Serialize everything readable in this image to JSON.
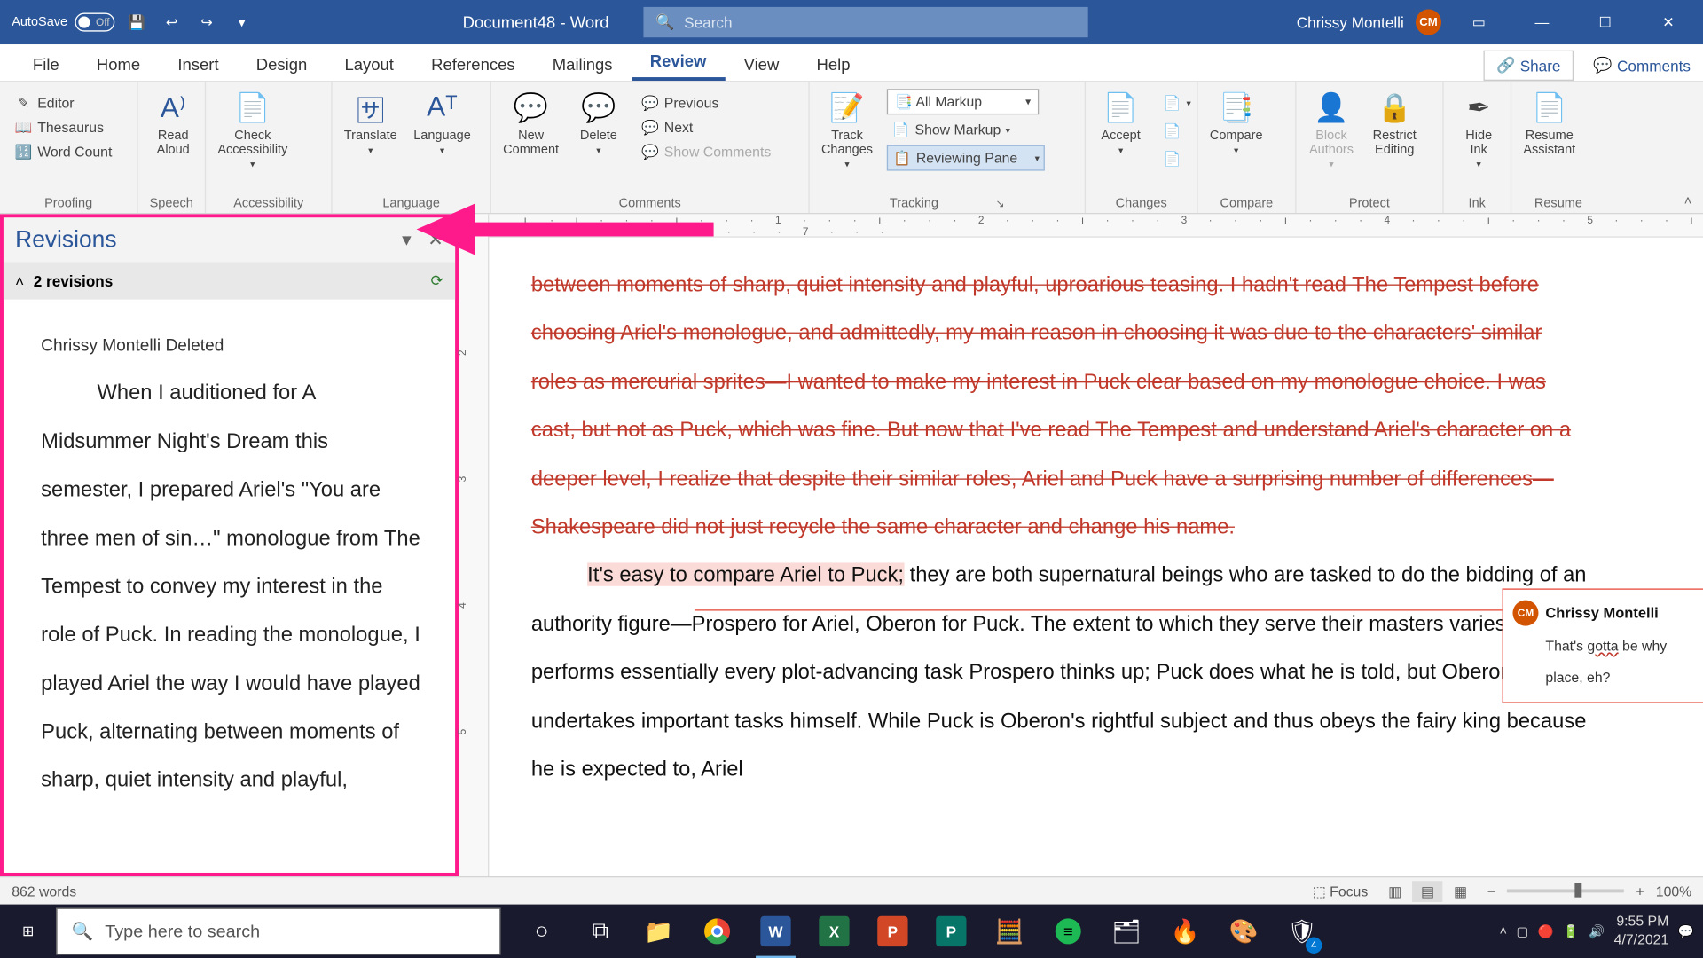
{
  "titlebar": {
    "autosave_label": "AutoSave",
    "autosave_state": "Off",
    "doc_title": "Document48 - Word",
    "search_placeholder": "Search",
    "user_name": "Chrissy Montelli",
    "user_initials": "CM"
  },
  "tabs": {
    "file": "File",
    "home": "Home",
    "insert": "Insert",
    "design": "Design",
    "layout": "Layout",
    "references": "References",
    "mailings": "Mailings",
    "review": "Review",
    "view": "View",
    "help": "Help",
    "share": "Share",
    "comments": "Comments"
  },
  "ribbon": {
    "proofing": {
      "editor": "Editor",
      "thesaurus": "Thesaurus",
      "word_count": "Word Count",
      "label": "Proofing"
    },
    "speech": {
      "read_aloud": "Read\nAloud",
      "label": "Speech"
    },
    "accessibility": {
      "check": "Check\nAccessibility",
      "label": "Accessibility"
    },
    "language": {
      "translate": "Translate",
      "language": "Language",
      "label": "Language"
    },
    "comments": {
      "new": "New\nComment",
      "delete": "Delete",
      "previous": "Previous",
      "next": "Next",
      "show": "Show Comments",
      "label": "Comments"
    },
    "tracking": {
      "track": "Track\nChanges",
      "all_markup": "All Markup",
      "show_markup": "Show Markup",
      "reviewing_pane": "Reviewing Pane",
      "label": "Tracking"
    },
    "changes": {
      "accept": "Accept",
      "label": "Changes"
    },
    "compare": {
      "compare": "Compare",
      "label": "Compare"
    },
    "protect": {
      "block": "Block\nAuthors",
      "restrict": "Restrict\nEditing",
      "label": "Protect"
    },
    "ink": {
      "hide": "Hide\nInk",
      "label": "Ink"
    },
    "resume": {
      "resume": "Resume\nAssistant",
      "label": "Resume"
    }
  },
  "revisions": {
    "title": "Revisions",
    "count": "2 revisions",
    "author_action": "Chrissy Montelli Deleted",
    "text": "When I auditioned for A Midsummer Night's Dream this semester, I prepared Ariel's \"You are three men of sin…\" monologue from The Tempest to convey my interest in the role of Puck. In reading the monologue, I played Ariel the way I would have played Puck, alternating between moments of sharp, quiet intensity and playful,"
  },
  "doc": {
    "deleted": "between moments of sharp, quiet intensity and playful, uproarious teasing. I hadn't read The Tempest before choosing Ariel's monologue, and admittedly, my main reason in choosing it was due to the characters' similar roles as mercurial sprites—I wanted to make my interest in Puck clear based on my monologue choice. I was cast, but not as Puck, which was fine. But now that I've read The Tempest and understand Ariel's character on a deeper level, I realize that despite their similar roles, Ariel and Puck have a surprising number of differences—Shakespeare did not just recycle the same character and change his name.",
    "highlight": "It's easy to compare Ariel to Puck;",
    "body_rest": " they are both supernatural beings who are tasked to do the bidding of an authority figure—Prospero for Ariel, Oberon for Puck. The extent to which they serve their masters varies: Ariel performs essentially every plot-advancing task Prospero thinks up; Puck does what he is told, but Oberon also undertakes important tasks himself. While Puck is Oberon's rightful subject and thus obeys the fairy king because he is expected to, Ariel"
  },
  "comment": {
    "initials": "CM",
    "name": "Chrissy Montelli",
    "text_pre": "That's ",
    "text_sq": "gotta",
    "text_post": " be why place, eh?"
  },
  "status": {
    "words": "862 words",
    "focus": "Focus",
    "zoom": "100%"
  },
  "taskbar": {
    "search": "Type here to search",
    "time": "9:55 PM",
    "date": "4/7/2021",
    "badge": "4"
  }
}
